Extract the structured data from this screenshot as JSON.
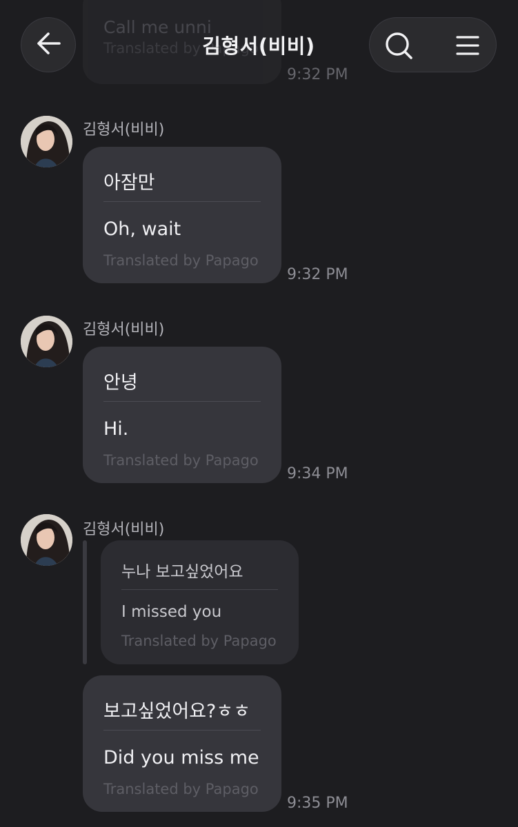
{
  "header": {
    "title": "김형서(비비)",
    "back_icon": "arrow-left-icon",
    "search_icon": "search-icon",
    "menu_icon": "menu-icon"
  },
  "previous_message": {
    "text": "Call me unni",
    "credit": "Translated by Papago",
    "time": "9:32 PM"
  },
  "messages": [
    {
      "sender": "김형서(비비)",
      "original": "아잠만",
      "translation": "Oh, wait",
      "credit": "Translated by Papago",
      "time": "9:32 PM"
    },
    {
      "sender": "김형서(비비)",
      "original": "안녕",
      "translation": "Hi.",
      "credit": "Translated by Papago",
      "time": "9:34 PM"
    },
    {
      "sender": "김형서(비비)",
      "quoted": {
        "original": "누나 보고싶었어요",
        "translation": "I missed you",
        "credit": "Translated by Papago"
      },
      "original": "보고싶었어요?ㅎㅎ",
      "translation": "Did you miss me",
      "credit": "Translated by Papago",
      "time": "9:35 PM"
    }
  ],
  "colors": {
    "background": "#1d1d20",
    "bubble": "#36363c",
    "quote_bubble": "#2c2c31",
    "credit_text": "#5e5e65",
    "timestamp": "#8e8e95"
  }
}
